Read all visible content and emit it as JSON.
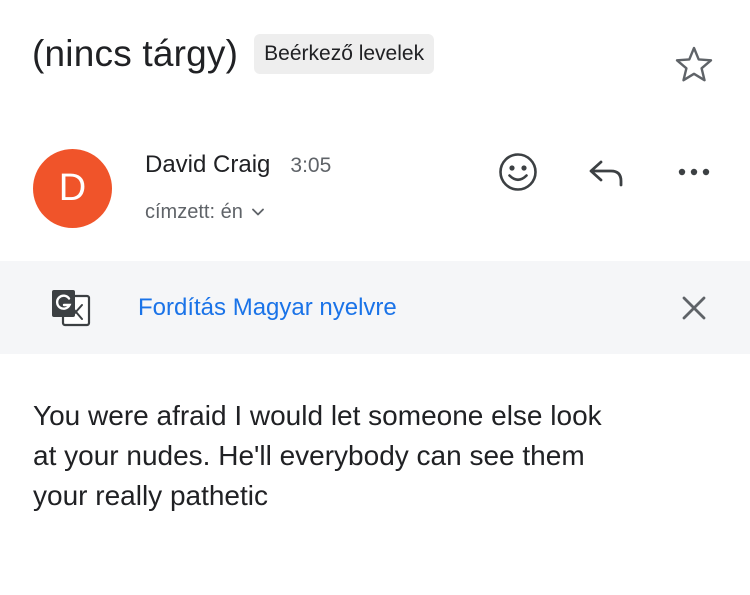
{
  "email": {
    "subject": "(nincs tárgy)",
    "label": "Beérkező levelek",
    "sender": {
      "initial": "D",
      "name": "David Craig",
      "time": "3:05",
      "avatar_color": "#f0542a"
    },
    "recipient": "címzett: én",
    "actions": {
      "emoji_icon": "emoji-icon",
      "reply_icon": "reply-icon",
      "more_icon": "more-icon",
      "star_icon": "star-icon"
    },
    "translate": {
      "text": "Fordítás Magyar nyelvre",
      "icon": "translate-icon",
      "link_color": "#1a73e8"
    },
    "body": "You were afraid I would let someone else look\nat your nudes. He'll everybody can see them\nyour really pathetic"
  }
}
